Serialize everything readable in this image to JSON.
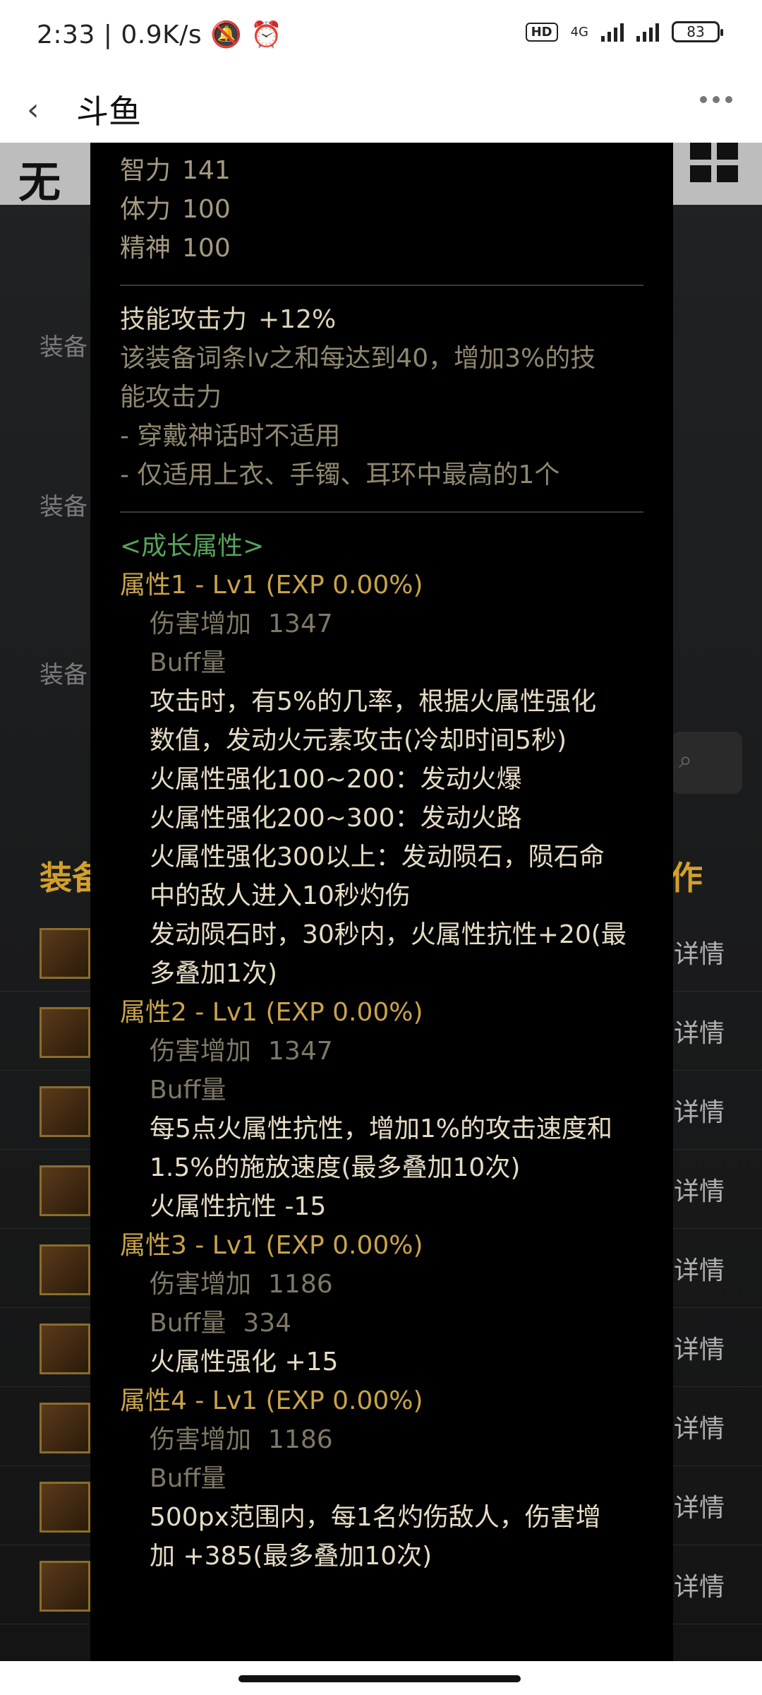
{
  "status": {
    "time": "2:33",
    "speed": "0.9K/s",
    "hd": "HD",
    "network": "4G",
    "battery": "83"
  },
  "appbar": {
    "title": "斗鱼"
  },
  "background": {
    "logo_char": "无",
    "labels": [
      "装备",
      "装备",
      "装备"
    ],
    "heading_left": "装备",
    "heading_right": "作",
    "row_detail_text": "详情"
  },
  "tooltip": {
    "stats": [
      {
        "name": "智力",
        "value": "141"
      },
      {
        "name": "体力",
        "value": "100"
      },
      {
        "name": "精神",
        "value": "100"
      }
    ],
    "skill": {
      "title": "技能攻击力",
      "value": "+12%",
      "lines": [
        "该装备词条lv之和每达到40，增加3%的技",
        "能攻击力",
        "- 穿戴神话时不适用",
        "- 仅适用上衣、手镯、耳环中最高的1个"
      ]
    },
    "growth_label": "<成长属性>",
    "attributes": [
      {
        "title": "属性1 - Lv1 (EXP 0.00%)",
        "damage_label": "伤害增加",
        "damage_value": "1347",
        "buff_label": "Buff量",
        "buff_value": "",
        "desc": [
          "攻击时，有5%的几率，根据火属性强化",
          "数值，发动火元素攻击(冷却时间5秒)",
          "火属性强化100~200：发动火爆",
          "火属性强化200~300：发动火路",
          "火属性强化300以上：发动陨石，陨石命",
          "中的敌人进入10秒灼伤",
          "发动陨石时，30秒内，火属性抗性+20(最",
          "多叠加1次)"
        ]
      },
      {
        "title": "属性2 - Lv1 (EXP 0.00%)",
        "damage_label": "伤害增加",
        "damage_value": "1347",
        "buff_label": "Buff量",
        "buff_value": "",
        "desc": [
          "每5点火属性抗性，增加1%的攻击速度和",
          "1.5%的施放速度(最多叠加10次)",
          "火属性抗性 -15"
        ]
      },
      {
        "title": "属性3 - Lv1 (EXP 0.00%)",
        "damage_label": "伤害增加",
        "damage_value": "1186",
        "buff_label": "Buff量",
        "buff_value": "334",
        "desc": [
          "火属性强化 +15"
        ]
      },
      {
        "title": "属性4 - Lv1 (EXP 0.00%)",
        "damage_label": "伤害增加",
        "damage_value": "1186",
        "buff_label": "Buff量",
        "buff_value": "",
        "desc": [
          "500px范围内，每1名灼伤敌人，伤害增",
          "加 +385(最多叠加10次)"
        ]
      }
    ]
  }
}
